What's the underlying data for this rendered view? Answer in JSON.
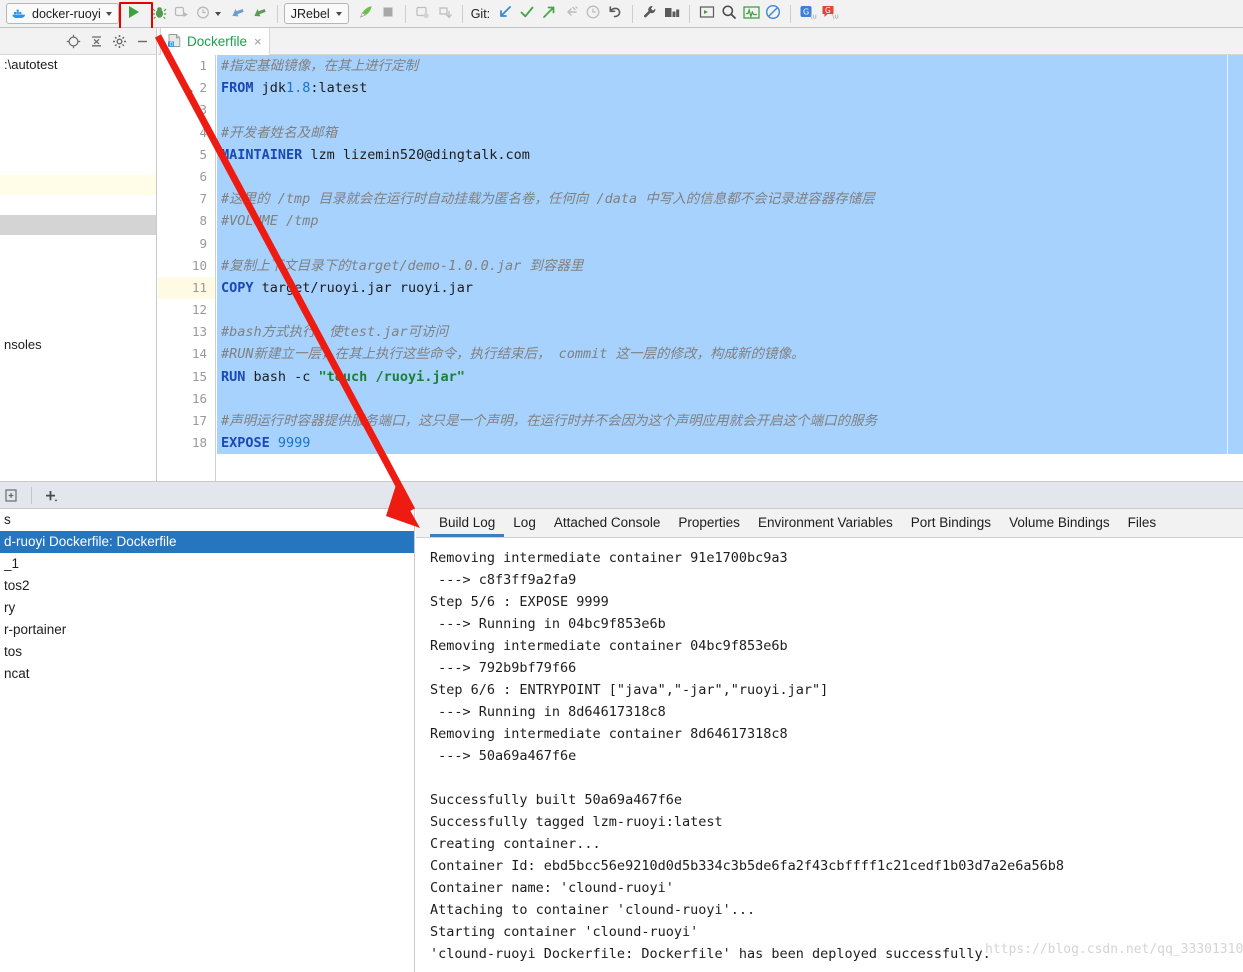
{
  "toolbar": {
    "run_config": {
      "label": "docker-ruoyi",
      "icon": "docker-whale-icon"
    },
    "buttons": [
      {
        "name": "run-button",
        "icon": "play-icon",
        "label": "Run"
      },
      {
        "name": "debug-button",
        "icon": "bug-icon",
        "label": "Debug"
      },
      {
        "name": "run-with-coverage-button",
        "icon": "run-coverage-icon",
        "label": "Run with Coverage"
      },
      {
        "name": "profile-button",
        "icon": "profile-clock-icon",
        "label": "Profile"
      },
      {
        "name": "attach-profiler-button",
        "icon": "attach-icon",
        "label": "Attach Profiler to Process"
      },
      {
        "name": "stop-background-button",
        "icon": "attach-alt-icon",
        "label": "Stop Background Processes"
      }
    ],
    "jrebel": {
      "label": "JRebel"
    },
    "jrebel_buttons": [
      {
        "name": "jrebel-run-button",
        "icon": "rocket-icon",
        "label": "Run with JRebel"
      },
      {
        "name": "jrebel-stop-button",
        "icon": "stop-square-icon",
        "label": "Stop"
      }
    ],
    "extra_buttons": [
      {
        "name": "update-application-button",
        "icon": "update-app-icon",
        "label": "Update Application"
      },
      {
        "name": "deploy-button",
        "icon": "deploy-icon",
        "label": "Deploy"
      }
    ],
    "git": {
      "label": "Git:",
      "actions": [
        {
          "name": "git-update-button",
          "icon": "arrow-down-left-icon",
          "label": "Update Project"
        },
        {
          "name": "git-commit-button",
          "icon": "checkmark-icon",
          "label": "Commit"
        },
        {
          "name": "git-push-button",
          "icon": "arrow-up-right-icon",
          "label": "Push"
        },
        {
          "name": "git-shelve-button",
          "icon": "shelve-icon",
          "label": "Shelve Changes"
        },
        {
          "name": "git-history-button",
          "icon": "clock-icon",
          "label": "Show History"
        },
        {
          "name": "git-rollback-button",
          "icon": "undo-icon",
          "label": "Rollback"
        }
      ]
    },
    "right_buttons": [
      {
        "name": "settings-button",
        "icon": "wrench-icon",
        "label": "Settings"
      },
      {
        "name": "project-structure-button",
        "icon": "project-structure-icon",
        "label": "Project Structure"
      },
      {
        "name": "terminal-button",
        "icon": "terminal-icon",
        "label": "Terminal"
      },
      {
        "name": "search-everywhere-button",
        "icon": "search-icon",
        "label": "Search Everywhere"
      },
      {
        "name": "monitor-button",
        "icon": "pulse-icon",
        "label": "Monitor"
      },
      {
        "name": "disable-button",
        "icon": "no-entry-icon",
        "label": "Disable"
      },
      {
        "name": "translate-button",
        "icon": "translate-blue-icon",
        "label": "Translate"
      },
      {
        "name": "translate-alt-button",
        "icon": "translate-red-icon",
        "label": "Translate Selection"
      }
    ]
  },
  "left_panel": {
    "header_icons": [
      {
        "name": "locate-icon",
        "label": "Select Opened File"
      },
      {
        "name": "collapse-all-icon",
        "label": "Collapse All"
      },
      {
        "name": "gear-icon",
        "label": "Settings"
      },
      {
        "name": "hide-icon",
        "label": "Hide"
      }
    ],
    "tree_rows": [
      {
        "label": ":\\autotest",
        "style": "plain"
      },
      {
        "label": "",
        "style": "plain"
      },
      {
        "label": "",
        "style": "plain"
      },
      {
        "label": "",
        "style": "plain"
      },
      {
        "label": "",
        "style": "plain"
      },
      {
        "label": "",
        "style": "plain"
      },
      {
        "label": "",
        "style": "yellow"
      },
      {
        "label": "",
        "style": "plain"
      },
      {
        "label": "",
        "style": "gray"
      },
      {
        "label": "",
        "style": "plain"
      },
      {
        "label": "",
        "style": "plain"
      },
      {
        "label": "",
        "style": "plain"
      },
      {
        "label": "",
        "style": "plain"
      },
      {
        "label": "",
        "style": "plain"
      },
      {
        "label": "nsoles",
        "style": "plain"
      }
    ]
  },
  "editor": {
    "tab": {
      "label": "Dockerfile",
      "icon": "dockerfile-icon",
      "close": "×"
    },
    "lines": [
      {
        "n": "1",
        "run_marker": false,
        "highlight": false,
        "selected": true,
        "tokens": [
          {
            "t": "cmt",
            "v": "#指定基础镜像，在其上进行定制"
          }
        ]
      },
      {
        "n": "2",
        "run_marker": true,
        "highlight": false,
        "selected": true,
        "tokens": [
          {
            "t": "kw",
            "v": "FROM"
          },
          {
            "t": "pln",
            "v": " jdk"
          },
          {
            "t": "num",
            "v": "1.8"
          },
          {
            "t": "pln",
            "v": ":latest"
          }
        ]
      },
      {
        "n": "3",
        "run_marker": false,
        "highlight": false,
        "selected": true,
        "tokens": []
      },
      {
        "n": "4",
        "run_marker": false,
        "highlight": false,
        "selected": true,
        "tokens": [
          {
            "t": "cmt",
            "v": "#开发者姓名及邮箱"
          }
        ]
      },
      {
        "n": "5",
        "run_marker": false,
        "highlight": false,
        "selected": true,
        "tokens": [
          {
            "t": "kw",
            "v": "MAINTAINER"
          },
          {
            "t": "pln",
            "v": " lzm lizemin520@dingtalk.com"
          }
        ]
      },
      {
        "n": "6",
        "run_marker": false,
        "highlight": false,
        "selected": true,
        "tokens": []
      },
      {
        "n": "7",
        "run_marker": false,
        "highlight": false,
        "selected": true,
        "tokens": [
          {
            "t": "cmt",
            "v": "#这里的 /tmp 目录就会在运行时自动挂载为匿名卷，任何向 /data 中写入的信息都不会记录进容器存储层"
          }
        ]
      },
      {
        "n": "8",
        "run_marker": false,
        "highlight": false,
        "selected": true,
        "tokens": [
          {
            "t": "cmt",
            "v": "#VOLUME /tmp"
          }
        ]
      },
      {
        "n": "9",
        "run_marker": false,
        "highlight": false,
        "selected": true,
        "tokens": []
      },
      {
        "n": "10",
        "run_marker": false,
        "highlight": false,
        "selected": true,
        "tokens": [
          {
            "t": "cmt",
            "v": "#复制上下文目录下的target/demo-1.0.0.jar 到容器里"
          }
        ]
      },
      {
        "n": "11",
        "run_marker": false,
        "highlight": true,
        "selected": true,
        "tokens": [
          {
            "t": "kw",
            "v": "COPY"
          },
          {
            "t": "pln",
            "v": " target/ruoyi.jar ruoyi.jar"
          }
        ]
      },
      {
        "n": "12",
        "run_marker": false,
        "highlight": false,
        "selected": true,
        "tokens": []
      },
      {
        "n": "13",
        "run_marker": false,
        "highlight": false,
        "selected": true,
        "tokens": [
          {
            "t": "cmt",
            "v": "#bash方式执行，使test.jar可访问"
          }
        ]
      },
      {
        "n": "14",
        "run_marker": false,
        "highlight": false,
        "selected": true,
        "tokens": [
          {
            "t": "cmt",
            "v": "#RUN新建立一层，在其上执行这些命令，执行结束后， commit 这一层的修改，构成新的镜像。"
          }
        ]
      },
      {
        "n": "15",
        "run_marker": false,
        "highlight": false,
        "selected": true,
        "tokens": [
          {
            "t": "kw",
            "v": "RUN"
          },
          {
            "t": "pln",
            "v": " bash -c "
          },
          {
            "t": "str",
            "v": "\"touch /ruoyi.jar\""
          }
        ]
      },
      {
        "n": "16",
        "run_marker": false,
        "highlight": false,
        "selected": true,
        "tokens": []
      },
      {
        "n": "17",
        "run_marker": false,
        "highlight": false,
        "selected": true,
        "tokens": [
          {
            "t": "cmt",
            "v": "#声明运行时容器提供服务端口，这只是一个声明，在运行时并不会因为这个声明应用就会开启这个端口的服务"
          }
        ]
      },
      {
        "n": "18",
        "run_marker": false,
        "highlight": false,
        "selected": true,
        "tokens": [
          {
            "t": "kw",
            "v": "EXPOSE"
          },
          {
            "t": "pln",
            "v": " "
          },
          {
            "t": "num",
            "v": "9999"
          }
        ]
      }
    ]
  },
  "bottom_strip": {
    "buttons": [
      {
        "name": "new-tab-button",
        "icon": "new-tab-icon",
        "label": "New Tab"
      },
      {
        "name": "add-button",
        "icon": "plus-icon",
        "label": "Add"
      }
    ]
  },
  "docker_tree": {
    "rows": [
      {
        "label": "s",
        "selected": false
      },
      {
        "label": "d-ruoyi Dockerfile: Dockerfile",
        "selected": true
      },
      {
        "label": "_1",
        "selected": false
      },
      {
        "label": "tos2",
        "selected": false
      },
      {
        "label": "ry",
        "selected": false
      },
      {
        "label": "r-portainer",
        "selected": false
      },
      {
        "label": "tos",
        "selected": false
      },
      {
        "label": "ncat",
        "selected": false
      }
    ]
  },
  "log_tabs": [
    {
      "label": "Build Log",
      "active": true
    },
    {
      "label": "Log",
      "active": false
    },
    {
      "label": "Attached Console",
      "active": false
    },
    {
      "label": "Properties",
      "active": false
    },
    {
      "label": "Environment Variables",
      "active": false
    },
    {
      "label": "Port Bindings",
      "active": false
    },
    {
      "label": "Volume Bindings",
      "active": false
    },
    {
      "label": "Files",
      "active": false
    }
  ],
  "build_log": [
    "Removing intermediate container 91e1700bc9a3",
    " ---> c8f3ff9a2fa9",
    "Step 5/6 : EXPOSE 9999",
    " ---> Running in 04bc9f853e6b",
    "Removing intermediate container 04bc9f853e6b",
    " ---> 792b9bf79f66",
    "Step 6/6 : ENTRYPOINT [\"java\",\"-jar\",\"ruoyi.jar\"]",
    " ---> Running in 8d64617318c8",
    "Removing intermediate container 8d64617318c8",
    " ---> 50a69a467f6e",
    "",
    "Successfully built 50a69a467f6e",
    "Successfully tagged lzm-ruoyi:latest",
    "Creating container...",
    "Container Id: ebd5bcc56e9210d0d5b334c3b5de6fa2f43cbffff1c21cedf1b03d7a2e6a56b8",
    "Container name: 'clound-ruoyi'",
    "Attaching to container 'clound-ruoyi'...",
    "Starting container 'clound-ruoyi'",
    "'clound-ruoyi Dockerfile: Dockerfile' has been deployed successfully."
  ],
  "watermark": {
    "text": "https://blog.csdn.net/qq_33301310"
  },
  "annotation": {
    "color": "#ee1b13",
    "description": "red-arrow-from-run-button-to-build-log-tab"
  },
  "colors": {
    "selection_blue": "#a7d2fd",
    "tree_selection_blue": "#2675bf",
    "tab_green": "#1aa14b",
    "keyword_blue": "#1a49b5",
    "string_green": "#1a7f37",
    "comment_gray": "#808080",
    "annotation_red": "#ee1b13",
    "active_tab_underline": "#3c7ec0"
  }
}
